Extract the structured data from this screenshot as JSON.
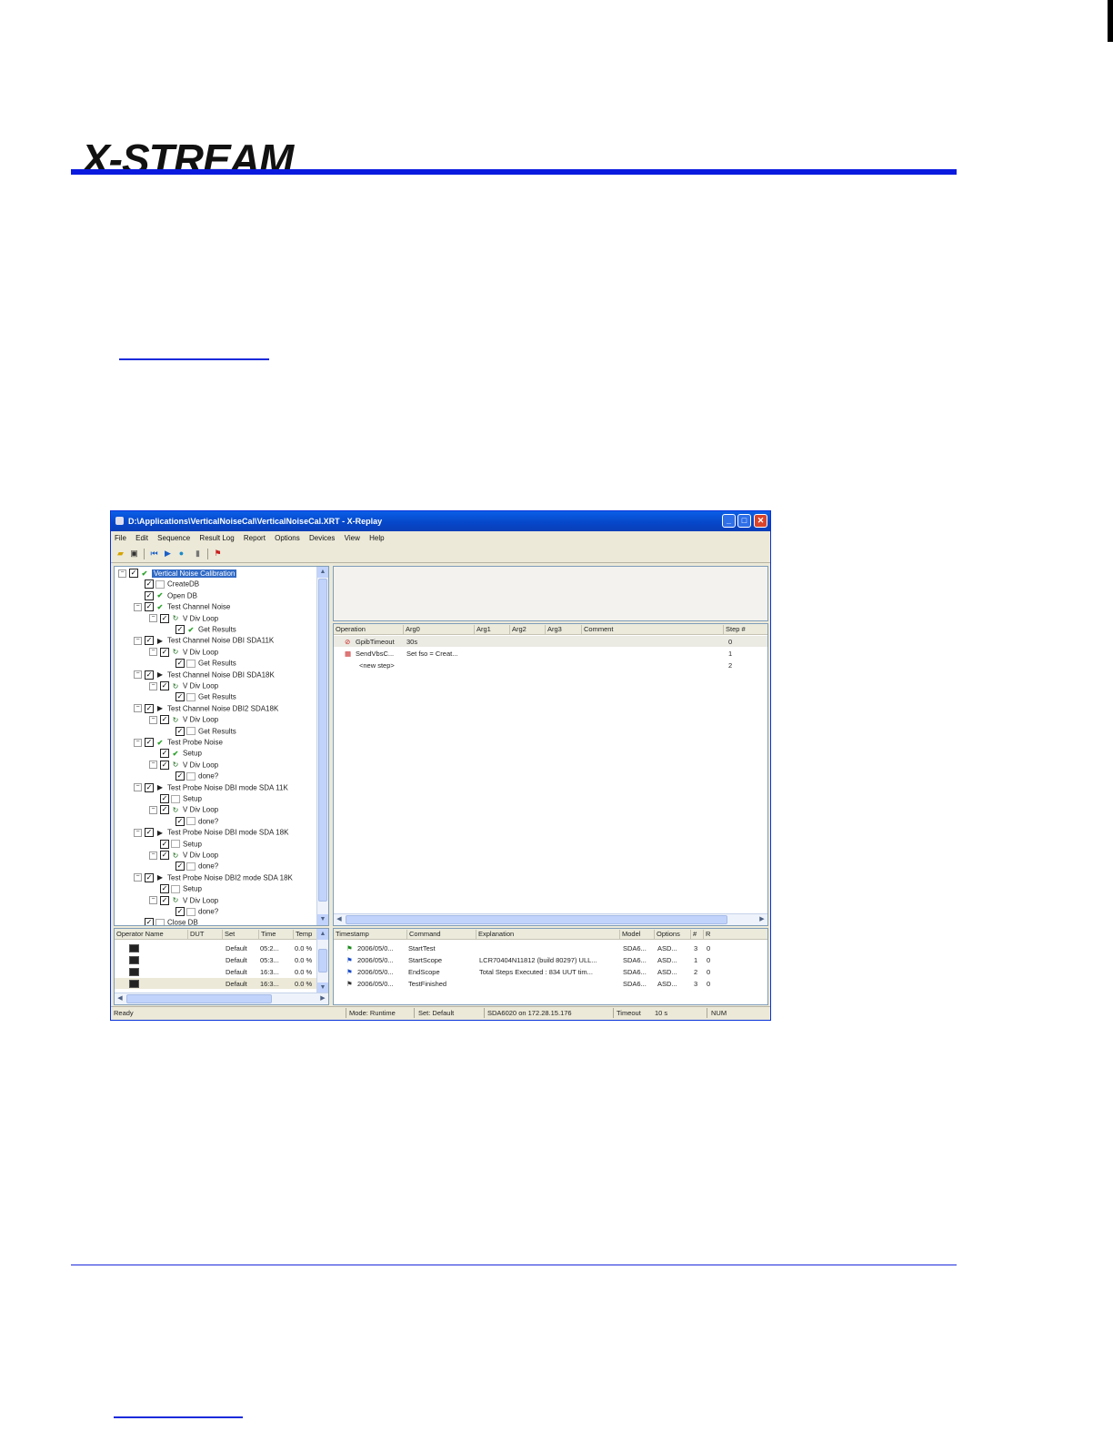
{
  "document": {
    "logo_text": "X-STREAM"
  },
  "window": {
    "title": "D:\\Applications\\VerticalNoiseCal\\VerticalNoiseCal.XRT - X-Replay",
    "buttons": {
      "minimize": "_",
      "maximize": "□",
      "close": "✕"
    },
    "menu": [
      "File",
      "Edit",
      "Sequence",
      "Result Log",
      "Report",
      "Options",
      "Devices",
      "View",
      "Help"
    ],
    "tree": [
      {
        "label": "Vertical Noise Calibration",
        "level": 0,
        "icon": "ok",
        "expand": "⊟",
        "selected": true
      },
      {
        "label": "CreateDB",
        "level": 1,
        "icon": "blank"
      },
      {
        "label": "Open DB",
        "level": 1,
        "icon": "ok"
      },
      {
        "label": "Test Channel Noise",
        "level": 1,
        "icon": "ok",
        "expand": "⊟"
      },
      {
        "label": "V Div Loop",
        "level": 2,
        "icon": "loop",
        "expand": "⊟"
      },
      {
        "label": "Get Results",
        "level": 3,
        "icon": "ok"
      },
      {
        "label": "Test Channel Noise DBI SDA11K",
        "level": 1,
        "icon": "run",
        "expand": "⊟"
      },
      {
        "label": "V Div Loop",
        "level": 2,
        "icon": "loop",
        "expand": "⊟"
      },
      {
        "label": "Get Results",
        "level": 3,
        "icon": "blank"
      },
      {
        "label": "Test Channel Noise DBI SDA18K",
        "level": 1,
        "icon": "run",
        "expand": "⊟"
      },
      {
        "label": "V Div Loop",
        "level": 2,
        "icon": "loop",
        "expand": "⊟"
      },
      {
        "label": "Get Results",
        "level": 3,
        "icon": "blank"
      },
      {
        "label": "Test Channel Noise DBI2 SDA18K",
        "level": 1,
        "icon": "run",
        "expand": "⊟"
      },
      {
        "label": "V Div Loop",
        "level": 2,
        "icon": "loop",
        "expand": "⊟"
      },
      {
        "label": "Get Results",
        "level": 3,
        "icon": "blank"
      },
      {
        "label": "Test Probe Noise",
        "level": 1,
        "icon": "ok",
        "expand": "⊟"
      },
      {
        "label": "Setup",
        "level": 2,
        "icon": "ok"
      },
      {
        "label": "V Div Loop",
        "level": 2,
        "icon": "loop",
        "expand": "⊟"
      },
      {
        "label": "done?",
        "level": 3,
        "icon": "blank"
      },
      {
        "label": "Test Probe Noise DBI mode SDA 11K",
        "level": 1,
        "icon": "run",
        "expand": "⊟"
      },
      {
        "label": "Setup",
        "level": 2,
        "icon": "blank"
      },
      {
        "label": "V Div Loop",
        "level": 2,
        "icon": "loop",
        "expand": "⊟"
      },
      {
        "label": "done?",
        "level": 3,
        "icon": "blank"
      },
      {
        "label": "Test Probe Noise DBI mode SDA 18K",
        "level": 1,
        "icon": "run",
        "expand": "⊟"
      },
      {
        "label": "Setup",
        "level": 2,
        "icon": "blank"
      },
      {
        "label": "V Div Loop",
        "level": 2,
        "icon": "loop",
        "expand": "⊟"
      },
      {
        "label": "done?",
        "level": 3,
        "icon": "blank"
      },
      {
        "label": "Test Probe Noise DBI2 mode SDA 18K",
        "level": 1,
        "icon": "run",
        "expand": "⊟"
      },
      {
        "label": "Setup",
        "level": 2,
        "icon": "blank"
      },
      {
        "label": "V Div Loop",
        "level": 2,
        "icon": "loop",
        "expand": "⊟"
      },
      {
        "label": "done?",
        "level": 3,
        "icon": "blank"
      },
      {
        "label": "Close DB",
        "level": 1,
        "icon": "blank"
      }
    ],
    "steps": {
      "columns": [
        "Operation",
        "Arg0",
        "Arg1",
        "Arg2",
        "Arg3",
        "Comment",
        "Step #"
      ],
      "rows": [
        {
          "operation": "GpibTimeout",
          "arg0": "30s",
          "step": "0"
        },
        {
          "operation": "SendVbsC...",
          "arg0": "Set fso = Creat...",
          "step": "1"
        },
        {
          "operation": "<new step>",
          "arg0": "",
          "step": "2"
        }
      ]
    },
    "results": {
      "columns": [
        "Operator Name",
        "DUT",
        "Set",
        "Time",
        "Temp"
      ],
      "rows": [
        {
          "set": "Default",
          "time": "05:2...",
          "temp": "0.0 %"
        },
        {
          "set": "Default",
          "time": "05:3...",
          "temp": "0.0 %"
        },
        {
          "set": "Default",
          "time": "16:3...",
          "temp": "0.0 %"
        },
        {
          "set": "Default",
          "time": "16:3...",
          "temp": "0.0 %"
        }
      ]
    },
    "events": {
      "columns": [
        "Timestamp",
        "Command",
        "Explanation",
        "Model",
        "Options",
        "#",
        "R"
      ],
      "rows": [
        {
          "timestamp": "2006/05/0...",
          "command": "StartTest",
          "explanation": "",
          "model": "SDA6...",
          "options": "ASD...",
          "num": "3",
          "r": "0"
        },
        {
          "timestamp": "2006/05/0...",
          "command": "StartScope",
          "explanation": "LCR70404N11812 (build 80297) ULL...",
          "model": "SDA6...",
          "options": "ASD...",
          "num": "1",
          "r": "0"
        },
        {
          "timestamp": "2006/05/0...",
          "command": "EndScope",
          "explanation": "Total Steps Executed : 834 UUT tim...",
          "model": "SDA6...",
          "options": "ASD...",
          "num": "2",
          "r": "0"
        },
        {
          "timestamp": "2006/05/0...",
          "command": "TestFinished",
          "explanation": "",
          "model": "SDA6...",
          "options": "ASD...",
          "num": "3",
          "r": "0"
        }
      ]
    },
    "status": {
      "ready": "Ready",
      "mode": "Mode: Runtime",
      "set": "Set: Default",
      "device": "SDA6020 on 172.28.15.176",
      "timeout_label": "Timeout",
      "timeout_value": "10 s",
      "num": "NUM"
    }
  }
}
